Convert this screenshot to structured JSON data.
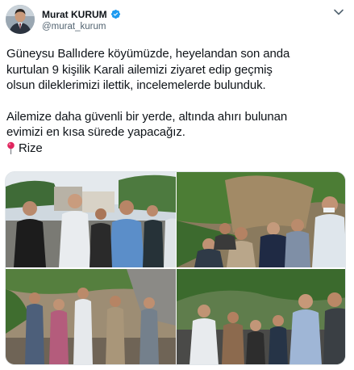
{
  "tweet": {
    "author": {
      "display_name": "Murat KURUM",
      "handle": "@murat_kurum",
      "verified": true,
      "verified_icon": "verified-badge-icon",
      "avatar_icon": "avatar"
    },
    "more_icon": "chevron-down-icon",
    "text": {
      "line1": "Güneysu Ballıdere köyümüzde, heyelandan son anda",
      "line2": "kurtulan 9 kişilik Karali ailemizi ziyaret edip geçmiş",
      "line3": "olsun dileklerimizi ilettik, incelemelerde bulunduk.",
      "line4": "Ailemize daha güvenli bir yerde, altında ahırı bulunan",
      "line5": "evimizi en kısa sürede yapacağız.",
      "location": "Rize",
      "location_icon": "round-pushpin-icon"
    },
    "photos": [
      {
        "name": "photo-1",
        "scene": "officials-meeting-villagers-outdoors"
      },
      {
        "name": "photo-2",
        "scene": "landslide-site-crowd"
      },
      {
        "name": "photo-3",
        "scene": "group-walking-muddy-road"
      },
      {
        "name": "photo-4",
        "scene": "officials-talking-with-family"
      }
    ],
    "colors": {
      "text": "#0f1419",
      "secondary": "#536471",
      "verified": "#1d9bf0",
      "pin": "#e0245e"
    }
  }
}
